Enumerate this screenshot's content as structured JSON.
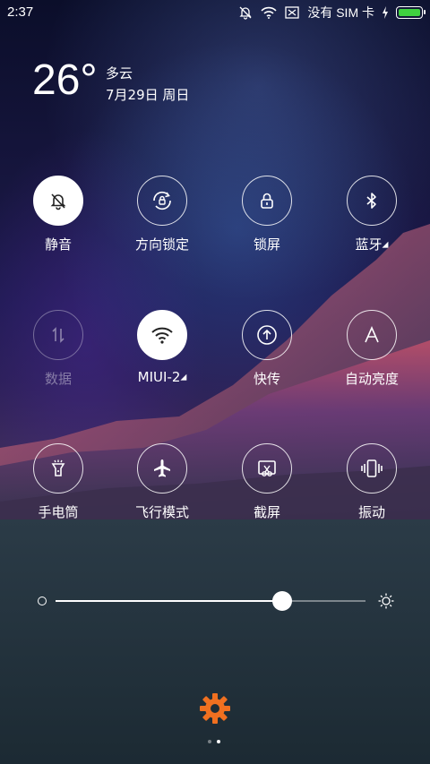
{
  "status_bar": {
    "time": "2:37",
    "sim_text": "没有 SIM 卡",
    "battery_level": 1.0,
    "battery_color": "#3fd13f",
    "icons": [
      "bell-off-icon",
      "wifi-icon",
      "sim-x-icon",
      "charging-bolt-icon",
      "battery-icon"
    ]
  },
  "weather": {
    "temperature": "26°",
    "condition": "多云",
    "date": "7月29日 周日"
  },
  "toggles": [
    {
      "label": "静音",
      "icon": "bell-off-icon",
      "state": "on"
    },
    {
      "label": "方向锁定",
      "icon": "rotation-lock-icon",
      "state": "off"
    },
    {
      "label": "锁屏",
      "icon": "lock-icon",
      "state": "off"
    },
    {
      "label": "蓝牙",
      "icon": "bluetooth-icon",
      "state": "off",
      "has_more": true
    },
    {
      "label": "数据",
      "icon": "mobile-data-icon",
      "state": "disabled"
    },
    {
      "label": "MIUI-2",
      "icon": "wifi-icon",
      "state": "on",
      "has_more": true
    },
    {
      "label": "快传",
      "icon": "quick-share-icon",
      "state": "off"
    },
    {
      "label": "自动亮度",
      "icon": "auto-brightness-icon",
      "state": "off"
    },
    {
      "label": "手电筒",
      "icon": "flashlight-icon",
      "state": "off"
    },
    {
      "label": "飞行模式",
      "icon": "airplane-icon",
      "state": "off"
    },
    {
      "label": "截屏",
      "icon": "screenshot-icon",
      "state": "off"
    },
    {
      "label": "振动",
      "icon": "vibrate-icon",
      "state": "off"
    }
  ],
  "brightness": {
    "level": 0.73,
    "min_icon": "brightness-low-icon",
    "max_icon": "brightness-high-icon"
  },
  "settings": {
    "icon": "gear-icon",
    "color": "#f07020"
  },
  "page_indicator": {
    "count": 2,
    "active": 2
  }
}
